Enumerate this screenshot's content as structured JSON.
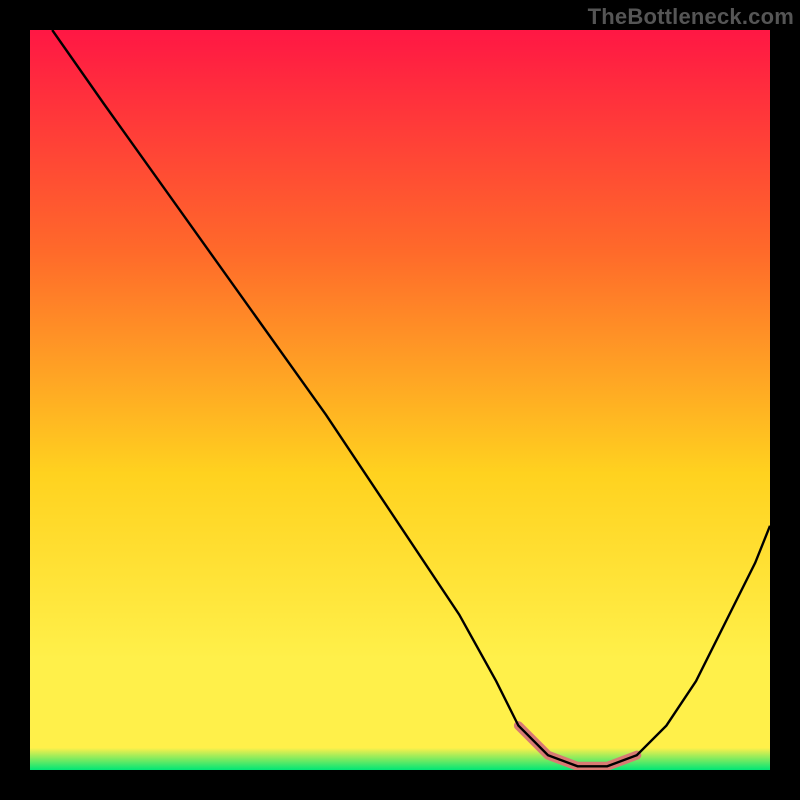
{
  "watermark": "TheBottleneck.com",
  "colors": {
    "bg": "#000000",
    "gradient_top": "#ff1744",
    "gradient_mid_upper": "#ff6a2a",
    "gradient_mid": "#ffd21f",
    "gradient_mid_lower": "#fff04a",
    "gradient_bottom": "#00e676",
    "curve": "#000000",
    "band": "#d87a73"
  },
  "chart_data": {
    "type": "line",
    "title": "",
    "xlabel": "",
    "ylabel": "",
    "xlim": [
      0,
      100
    ],
    "ylim": [
      0,
      100
    ],
    "series": [
      {
        "name": "curve",
        "x": [
          3,
          10,
          20,
          30,
          40,
          50,
          58,
          63,
          66,
          70,
          74,
          78,
          82,
          86,
          90,
          94,
          98,
          100
        ],
        "y": [
          100,
          90,
          76,
          62,
          48,
          33,
          21,
          12,
          6,
          2,
          0.5,
          0.5,
          2,
          6,
          12,
          20,
          28,
          33
        ]
      },
      {
        "name": "optimal-band",
        "x": [
          66,
          70,
          74,
          78,
          82
        ],
        "y": [
          6,
          2,
          0.5,
          0.5,
          2
        ]
      }
    ]
  }
}
